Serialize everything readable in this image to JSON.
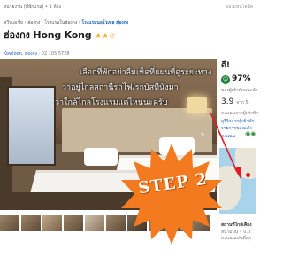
{
  "header": {
    "left_text": "หน่วยงาน (ที่พักแรม) • 1 ห้อง",
    "right_text": "ของแพนโฮดีพ"
  },
  "breadcrumb": {
    "items": [
      "ทวีปเอเชีย",
      "ฮ่องกง",
      "โรงแรมในฮ่องกง"
    ],
    "current": "โรงแรมนอโวเทล ฮ่องกง"
  },
  "hotel": {
    "name": "ฮ่องกง Hong Kong",
    "stars": "★★✩",
    "area": "Kowloon, ฮ่องกง",
    "phone": "02 105 5728"
  },
  "overlay": {
    "line1": "เลือกที่พักอย่าลืมเช็คที่แผนที่ดูระยะทาง",
    "line2": "ว่าอยู่ไกลสถานีรถไฟ/รถบัสที่นั่งมา",
    "line3": "ว่าใกล้ไกลโรงแรมแค่ไหนนะครับ"
  },
  "next_icon": "chevron-right-icon",
  "thumbnails": [
    "thumb1",
    "thumb2",
    "thumb3",
    "thumb4",
    "thumb5",
    "thumb6",
    "thumb7",
    "thumb8",
    "thumb9",
    "thumb10"
  ],
  "review": {
    "score_label": "ดี!",
    "percent": "97%",
    "percent_sub": "ของผู้เข้าพักแนะนำ",
    "rating_value": "3.9",
    "rating_scale": "จาก 5",
    "rating_sub": "คะแนนจากผู้เข้าพัก",
    "link1": "ดูรีวิวจากผู้เข้าพัก",
    "link2": "รายการของแล้ว",
    "link3": "คะแนน"
  },
  "map": {
    "title": "สถานที่ใกล้เคียง",
    "line2": "สนามบิน • 0.3",
    "line3": "คะแนนเด่นที่สุด"
  },
  "sticker": {
    "label": "STEP 2",
    "color": "#f47a1f",
    "arrow_color": "#e01b24"
  }
}
